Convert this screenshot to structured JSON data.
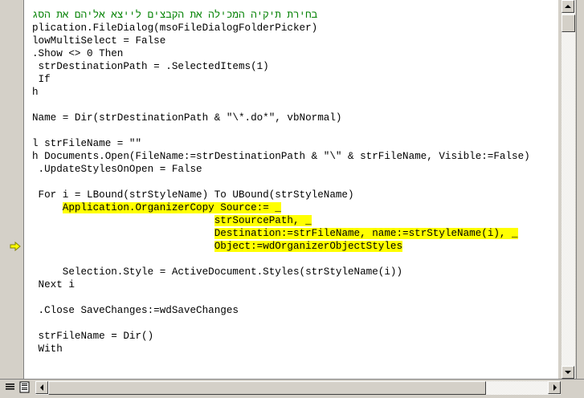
{
  "editor": {
    "lines": [
      {
        "text": "בחירת תיקיה המכילה את הקבצים לייצא אליהם את הסג",
        "kind": "comment"
      },
      {
        "text": "plication.FileDialog(msoFileDialogFolderPicker)",
        "kind": "code"
      },
      {
        "text": "lowMultiSelect = False",
        "kind": "code"
      },
      {
        "text": ".Show <> 0 Then",
        "kind": "code"
      },
      {
        "text": " strDestinationPath = .SelectedItems(1)",
        "kind": "code"
      },
      {
        "text": " If",
        "kind": "code"
      },
      {
        "text": "h",
        "kind": "code"
      },
      {
        "text": "",
        "kind": "code"
      },
      {
        "text": "Name = Dir(strDestinationPath & \"\\*.do*\", vbNormal)",
        "kind": "code"
      },
      {
        "text": "",
        "kind": "code"
      },
      {
        "text": "l strFileName = \"\"",
        "kind": "code"
      },
      {
        "text": "h Documents.Open(FileName:=strDestinationPath & \"\\\" & strFileName, Visible:=False)",
        "kind": "code"
      },
      {
        "text": " .UpdateStylesOnOpen = False",
        "kind": "code"
      },
      {
        "text": "",
        "kind": "code"
      },
      {
        "text": " For i = LBound(strStyleName) To UBound(strStyleName)",
        "kind": "code"
      },
      {
        "indent": "     ",
        "text": "Application.OrganizerCopy Source:= _",
        "kind": "highlight"
      },
      {
        "indent": "                              ",
        "text": "strSourcePath, _",
        "kind": "highlight"
      },
      {
        "indent": "                              ",
        "text": "Destination:=strFileName, name:=strStyleName(i), _",
        "kind": "highlight"
      },
      {
        "indent": "                              ",
        "text": "Object:=wdOrganizerObjectStyles",
        "kind": "highlight"
      },
      {
        "text": "",
        "kind": "code"
      },
      {
        "text": "     Selection.Style = ActiveDocument.Styles(strStyleName(i))",
        "kind": "code"
      },
      {
        "text": " Next i",
        "kind": "code"
      },
      {
        "text": "",
        "kind": "code"
      },
      {
        "text": " .Close SaveChanges:=wdSaveChanges",
        "kind": "code"
      },
      {
        "text": "",
        "kind": "code"
      },
      {
        "text": " strFileName = Dir()",
        "kind": "code"
      },
      {
        "text": " With",
        "kind": "code"
      }
    ],
    "execution_line_index": 18
  },
  "icons": {
    "execution_pointer": "execution-arrow-icon",
    "procedure_view": "procedure-view-icon",
    "full_module_view": "full-module-view-icon",
    "scroll_up": "arrow-up-icon",
    "scroll_down": "arrow-down-icon",
    "scroll_left": "arrow-left-icon",
    "scroll_right": "arrow-right-icon"
  },
  "colors": {
    "comment": "#008000",
    "highlight": "#ffff00",
    "execution_arrow": "#ffff00"
  }
}
